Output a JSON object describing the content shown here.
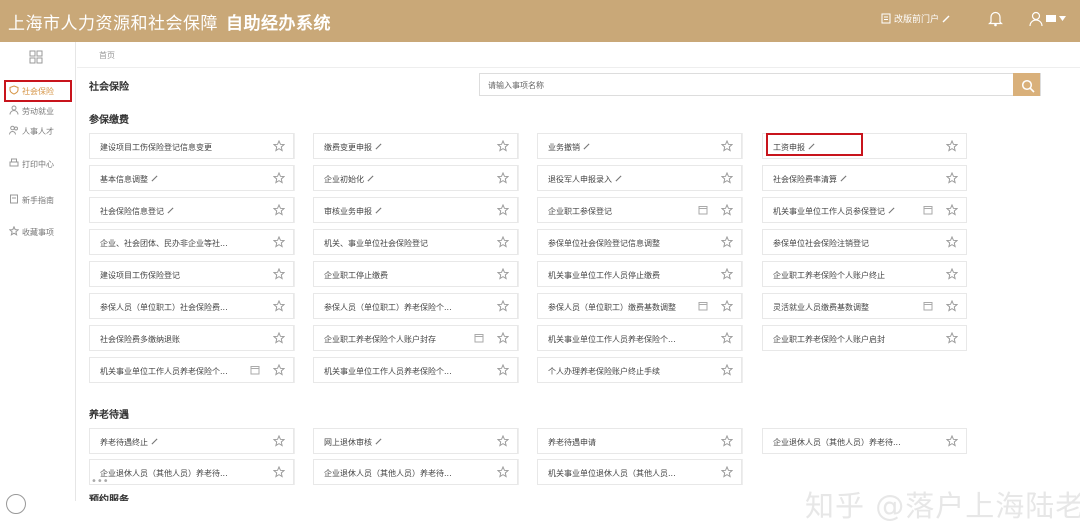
{
  "header": {
    "title_main": "上海市人力资源和社会保障",
    "title_sub": "自助经办系统",
    "portal_link": "改版前门户"
  },
  "sidebar": {
    "items": [
      {
        "label": "社会保险",
        "icon": "shield-icon"
      },
      {
        "label": "劳动就业",
        "icon": "person-icon"
      },
      {
        "label": "人事人才",
        "icon": "people-icon"
      },
      {
        "label": "打印中心",
        "icon": "printer-icon"
      },
      {
        "label": "新手指南",
        "icon": "guide-icon"
      },
      {
        "label": "收藏事项",
        "icon": "star-icon"
      }
    ]
  },
  "breadcrumb": "首页",
  "section_title": "社会保险",
  "search": {
    "placeholder": "请输入事项名称"
  },
  "groups": [
    {
      "title": "参保缴费",
      "items": [
        "建设项目工伤保险登记信息变更",
        "缴费变更申报",
        "业务撤销",
        "工资申报",
        "基本信息调整",
        "企业初始化",
        "退役军人申报录入",
        "社会保险费率清算",
        "社会保险信息登记",
        "审核业务申报",
        "企业职工参保登记",
        "机关事业单位工作人员参保登记",
        "企业、社会团体、民办非企业等社...",
        "机关、事业单位社会保险登记",
        "参保单位社会保险登记信息调整",
        "参保单位社会保险注销登记",
        "建设项目工伤保险登记",
        "企业职工停止缴费",
        "机关事业单位工作人员停止缴费",
        "企业职工养老保险个人账户终止",
        "参保人员（单位职工）社会保险费...",
        "参保人员（单位职工）养老保险个...",
        "参保人员（单位职工）缴费基数调整",
        "灵活就业人员缴费基数调整",
        "社会保险费多缴纳退账",
        "企业职工养老保险个人账户封存",
        "机关事业单位工作人员养老保险个...",
        "企业职工养老保险个人账户启封",
        "机关事业单位工作人员养老保险个...",
        "机关事业单位工作人员养老保险个...",
        "个人办理养老保险账户终止手续"
      ]
    },
    {
      "title": "养老待遇",
      "items": [
        "养老待遇终止",
        "网上退休审核",
        "养老待遇申请",
        "企业退休人员（其他人员）养老待...",
        "企业退休人员（其他人员）养老待...",
        "企业退休人员（其他人员）养老待...",
        "机关事业单位退休人员（其他人员..."
      ]
    }
  ],
  "more_indicator": "•••",
  "truncated_group_title": "预约服务",
  "watermark": "知乎 @落户上海陆老师"
}
